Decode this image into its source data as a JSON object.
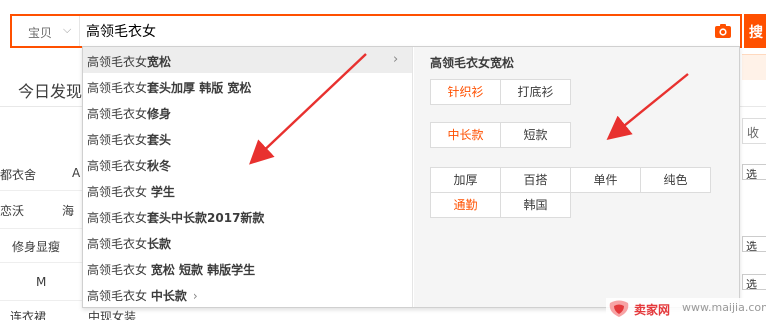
{
  "search": {
    "type_label": "宝贝",
    "query": "高领毛衣女",
    "submit_glyph": "搜"
  },
  "page": {
    "today_tab": "今日发现",
    "right_label": "收起",
    "left_rows": [
      {
        "left": "都衣舍",
        "right": "A"
      },
      {
        "left": "恋沃",
        "right": "海"
      },
      {
        "left": "修身显瘦",
        "right": ""
      },
      {
        "left": "M",
        "right": ""
      },
      {
        "left": "连衣裙",
        "right": "中现女装"
      }
    ],
    "select_label": "选"
  },
  "suggestions": [
    {
      "prefix": "高领毛衣女",
      "bold": "宽松",
      "has_arrow": true
    },
    {
      "prefix": "高领毛衣女",
      "bold": "套头加厚 韩版 宽松",
      "has_arrow": false
    },
    {
      "prefix": "高领毛衣女",
      "bold": "修身",
      "has_arrow": false
    },
    {
      "prefix": "高领毛衣女",
      "bold": "套头",
      "has_arrow": false
    },
    {
      "prefix": "高领毛衣女",
      "bold": "秋冬",
      "has_arrow": false
    },
    {
      "prefix": "高领毛衣女 ",
      "bold": "学生",
      "has_arrow": false
    },
    {
      "prefix": "高领毛衣女",
      "bold": "套头中长款2017新款",
      "has_arrow": false
    },
    {
      "prefix": "高领毛衣女",
      "bold": "长款",
      "has_arrow": false
    },
    {
      "prefix": "高领毛衣女 ",
      "bold": "宽松 短款 韩版学生",
      "has_arrow": false
    },
    {
      "prefix": "高领毛衣女 ",
      "bold": "中长款",
      "has_arrow": true
    }
  ],
  "detail": {
    "title": "高领毛衣女宽松",
    "group1": [
      "针织衫",
      "打底衫"
    ],
    "group2": [
      "中长款",
      "短款"
    ],
    "group3": [
      "加厚",
      "百搭",
      "单件",
      "纯色",
      "通勤",
      "韩国"
    ]
  },
  "watermark": {
    "brand": "卖家网",
    "url": "www.maijia.com"
  },
  "colors": {
    "accent": "#ff5000",
    "highlight_text": "#ff5000",
    "annotation_arrow": "#e8312f"
  }
}
